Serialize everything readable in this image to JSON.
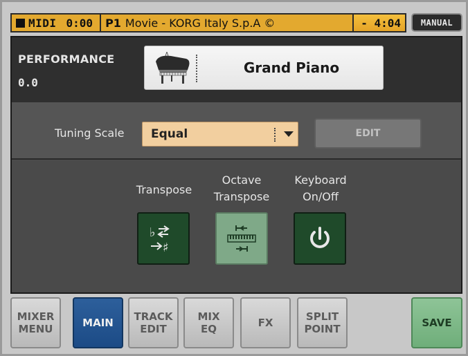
{
  "status_bar": {
    "midi_label": "MIDI",
    "time_elapsed": "0:00",
    "performance_slot": "P1",
    "performance_name": "Movie - KORG Italy S.p.A ©",
    "time_remaining": "- 4:04",
    "mode_badge": "MANUAL"
  },
  "performance": {
    "title": "PERFORMANCE",
    "value": "0.0",
    "sound_name": "Grand Piano",
    "sound_icon": "grand-piano-icon"
  },
  "tuning": {
    "label": "Tuning Scale",
    "value": "Equal",
    "edit_label": "EDIT"
  },
  "controls": {
    "transpose_label": "Transpose",
    "octave_label": "Octave\nTranspose",
    "keyboard_label": "Keyboard\nOn/Off",
    "transpose_icon": "flat-sharp-transpose-icon",
    "octave_icon": "keyboard-octave-icon",
    "keyboard_icon": "power-icon"
  },
  "bottom_bar": {
    "mixer_menu": "MIXER\nMENU",
    "main": "MAIN",
    "track_edit": "TRACK\nEDIT",
    "mix_eq": "MIX\nEQ",
    "fx": "FX",
    "split_point": "SPLIT\nPOINT",
    "save": "SAVE"
  },
  "colors": {
    "status_bar_bg": "#e3a92f",
    "main_button_bg": "#1c4b86",
    "save_button_bg": "#6fae7a",
    "tuning_select_bg": "#f2cf9f",
    "control_button_active": "#1f4a2a",
    "control_button_light": "#7fa988"
  }
}
